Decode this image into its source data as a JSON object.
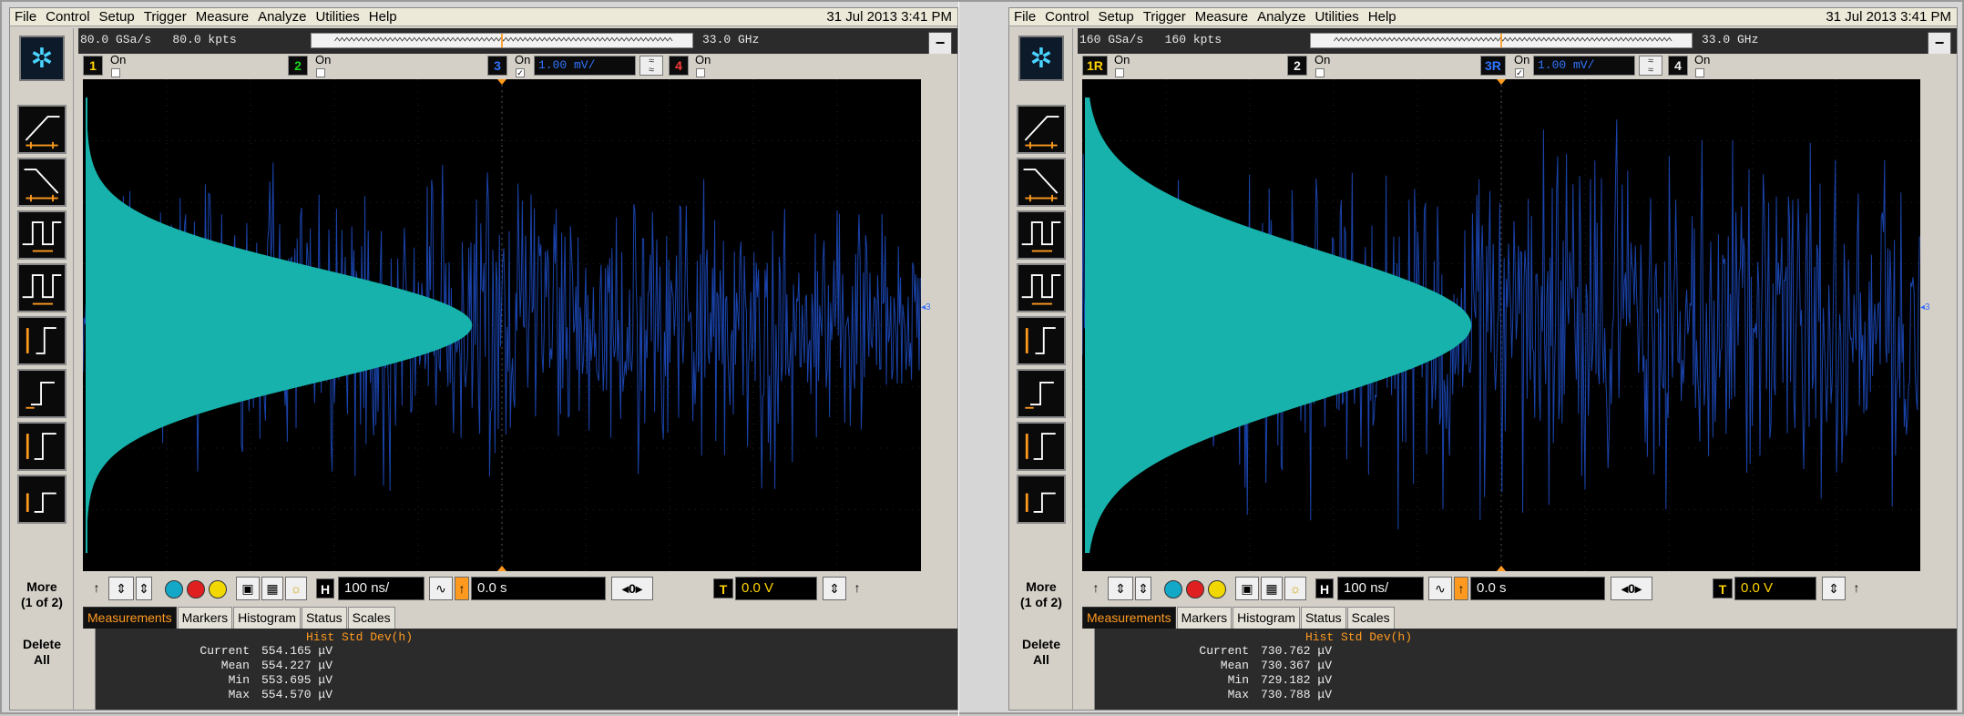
{
  "colors": {
    "waveform": "#1e4fc8",
    "histogram": "#17b2ac",
    "ch1": "#ffd400",
    "ch2": "#1ed41e",
    "ch3": "#2f74ff",
    "ch4": "#ff3b3b",
    "accent": "#ff9a1f"
  },
  "panels": [
    {
      "menu": [
        "File",
        "Control",
        "Setup",
        "Trigger",
        "Measure",
        "Analyze",
        "Utilities",
        "Help"
      ],
      "datetime": "31 Jul 2013  3:41 PM",
      "sample_rate": "80.0 GSa/s",
      "memory": "80.0 kpts",
      "bandwidth": "33.0 GHz",
      "channels": [
        {
          "label": "1",
          "state": "On"
        },
        {
          "label": "2",
          "state": "On"
        },
        {
          "label": "3",
          "state": "On"
        },
        {
          "label": "4",
          "state": "On"
        }
      ],
      "ch_scale": "1.00 mV/",
      "sidebar_more": "More\n(1 of 2)",
      "sidebar_delete": "Delete\nAll",
      "horizontal_scale": "100 ns/",
      "delay": "0.0 s",
      "delay_index": "0",
      "trigger_level": "0.0 V",
      "hist_peak_fraction": 0.5,
      "tabs": [
        "Measurements",
        "Markers",
        "Histogram",
        "Status",
        "Scales"
      ],
      "meas_title": "Hist Std Dev(h)",
      "meas": [
        {
          "label": "Current",
          "value": "554.165 μV"
        },
        {
          "label": "Mean",
          "value": "554.227 μV"
        },
        {
          "label": "Min",
          "value": "553.695 μV"
        },
        {
          "label": "Max",
          "value": "554.570 μV"
        }
      ]
    },
    {
      "menu": [
        "File",
        "Control",
        "Setup",
        "Trigger",
        "Measure",
        "Analyze",
        "Utilities",
        "Help"
      ],
      "datetime": "31 Jul 2013  3:41 PM",
      "sample_rate": "160 GSa/s",
      "memory": "160 kpts",
      "bandwidth": "33.0 GHz",
      "channels": [
        {
          "label": "1R",
          "state": "On"
        },
        {
          "label": "2",
          "state": "On"
        },
        {
          "label": "3R",
          "state": "On"
        },
        {
          "label": "4",
          "state": "On"
        }
      ],
      "ch_scale": "1.00 mV/",
      "sidebar_more": "More\n(1 of 2)",
      "sidebar_delete": "Delete\nAll",
      "horizontal_scale": "100 ns/",
      "delay": "0.0 s",
      "delay_index": "0",
      "trigger_level": "0.0 V",
      "hist_peak_fraction": 0.5,
      "tabs": [
        "Measurements",
        "Markers",
        "Histogram",
        "Status",
        "Scales"
      ],
      "meas_title": "Hist Std Dev(h)",
      "meas": [
        {
          "label": "Current",
          "value": "730.762 μV"
        },
        {
          "label": "Mean",
          "value": "730.367 μV"
        },
        {
          "label": "Min",
          "value": "729.182 μV"
        },
        {
          "label": "Max",
          "value": "730.788 μV"
        }
      ]
    }
  ]
}
